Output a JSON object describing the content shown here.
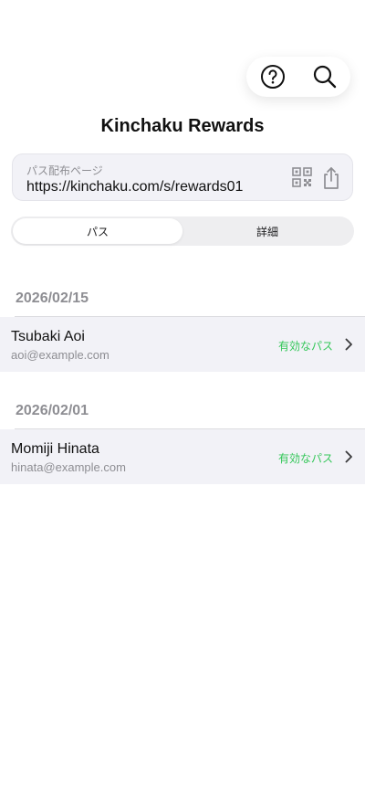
{
  "header": {
    "title": "Kinchaku Rewards",
    "actions": [
      {
        "icon": "help-circle-icon"
      },
      {
        "icon": "search-icon"
      }
    ]
  },
  "pass_url": {
    "label": "パス配布ページ",
    "value": "https://kinchaku.com/s/rewards01",
    "qr_icon": "qr-code-icon",
    "share_icon": "share-icon"
  },
  "tabs": [
    {
      "label": "パス",
      "active": true
    },
    {
      "label": "詳細",
      "active": false
    }
  ],
  "groups": [
    {
      "date": "2026/02/15",
      "items": [
        {
          "name": "Tsubaki Aoi",
          "email": "aoi@example.com",
          "status": "有効なパス"
        }
      ]
    },
    {
      "date": "2026/02/01",
      "items": [
        {
          "name": "Momiji Hinata",
          "email": "hinata@example.com",
          "status": "有効なパス"
        }
      ]
    }
  ],
  "colors": {
    "status_active": "#34c759",
    "background": "#ffffff",
    "row_background": "#f2f2f7",
    "secondary_text": "#8e8e93"
  }
}
